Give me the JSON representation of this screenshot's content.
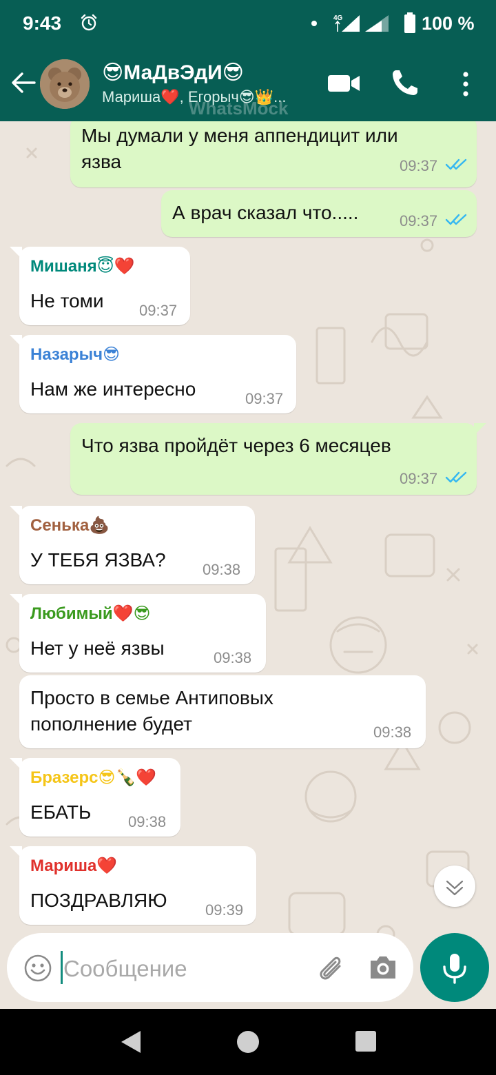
{
  "status_bar": {
    "time": "9:43",
    "network": "4G",
    "battery": "100 %",
    "icons": [
      "alarm-icon",
      "notification-dot-icon",
      "signal-icon",
      "battery-icon"
    ]
  },
  "header": {
    "title": "😎МаДвЭдИ😎",
    "subtitle": "Мариша❤️, Егорыч😎👑...",
    "watermark": "WhatsMock",
    "icons": [
      "back-arrow-icon",
      "video-call-icon",
      "phone-call-icon",
      "more-options-icon"
    ]
  },
  "colors": {
    "header": "#075e54",
    "outgoing_bubble": "#dcf8c6",
    "incoming_bubble": "#ffffff",
    "chat_background": "#ece5dd",
    "read_ticks": "#34b7f1",
    "mic_button": "#00897b"
  },
  "messages": [
    {
      "direction": "out",
      "sender": "",
      "text": [
        "Мы думали у меня аппендицит или",
        "язва"
      ],
      "time": "09:37",
      "status": "read"
    },
    {
      "direction": "out",
      "sender": "",
      "text": [
        "А врач сказал что....."
      ],
      "time": "09:37",
      "status": "read"
    },
    {
      "direction": "in",
      "sender": "Мишаня😇❤️",
      "sender_color": "#00897b",
      "text": [
        "Не томи"
      ],
      "time": "09:37"
    },
    {
      "direction": "in",
      "sender": "Назарыч😎",
      "sender_color": "#3b82d6",
      "text": [
        "Нам же интересно"
      ],
      "time": "09:37"
    },
    {
      "direction": "out",
      "sender": "",
      "text": [
        "Что язва пройдёт через 6 месяцев"
      ],
      "time": "09:37",
      "status": "read"
    },
    {
      "direction": "in",
      "sender": "Сенька💩",
      "sender_color": "#a1603f",
      "text": [
        "У ТЕБЯ ЯЗВА?"
      ],
      "time": "09:38"
    },
    {
      "direction": "in",
      "sender": "Любимый❤️😎",
      "sender_color": "#3a9a1e",
      "text": [
        "Нет у неё язвы"
      ],
      "time": "09:38"
    },
    {
      "direction": "in",
      "sender": "",
      "text": [
        "Просто в семье Антиповых",
        "пополнение будет"
      ],
      "time": "09:38"
    },
    {
      "direction": "in",
      "sender": "Бразерс😎🍾❤️",
      "sender_color": "#f5c518",
      "text": [
        "ЕБАТЬ"
      ],
      "time": "09:38"
    },
    {
      "direction": "in",
      "sender": "Мариша❤️",
      "sender_color": "#e0312c",
      "text": [
        "ПОЗДРАВЛЯЮ"
      ],
      "time": "09:39"
    }
  ],
  "composer": {
    "placeholder": "Сообщение",
    "icons": [
      "emoji-icon",
      "paperclip-icon",
      "camera-icon",
      "microphone-icon",
      "chevron-down-icon"
    ]
  },
  "nav_bar": {
    "icons": [
      "nav-back-icon",
      "nav-home-icon",
      "nav-recents-icon"
    ]
  }
}
